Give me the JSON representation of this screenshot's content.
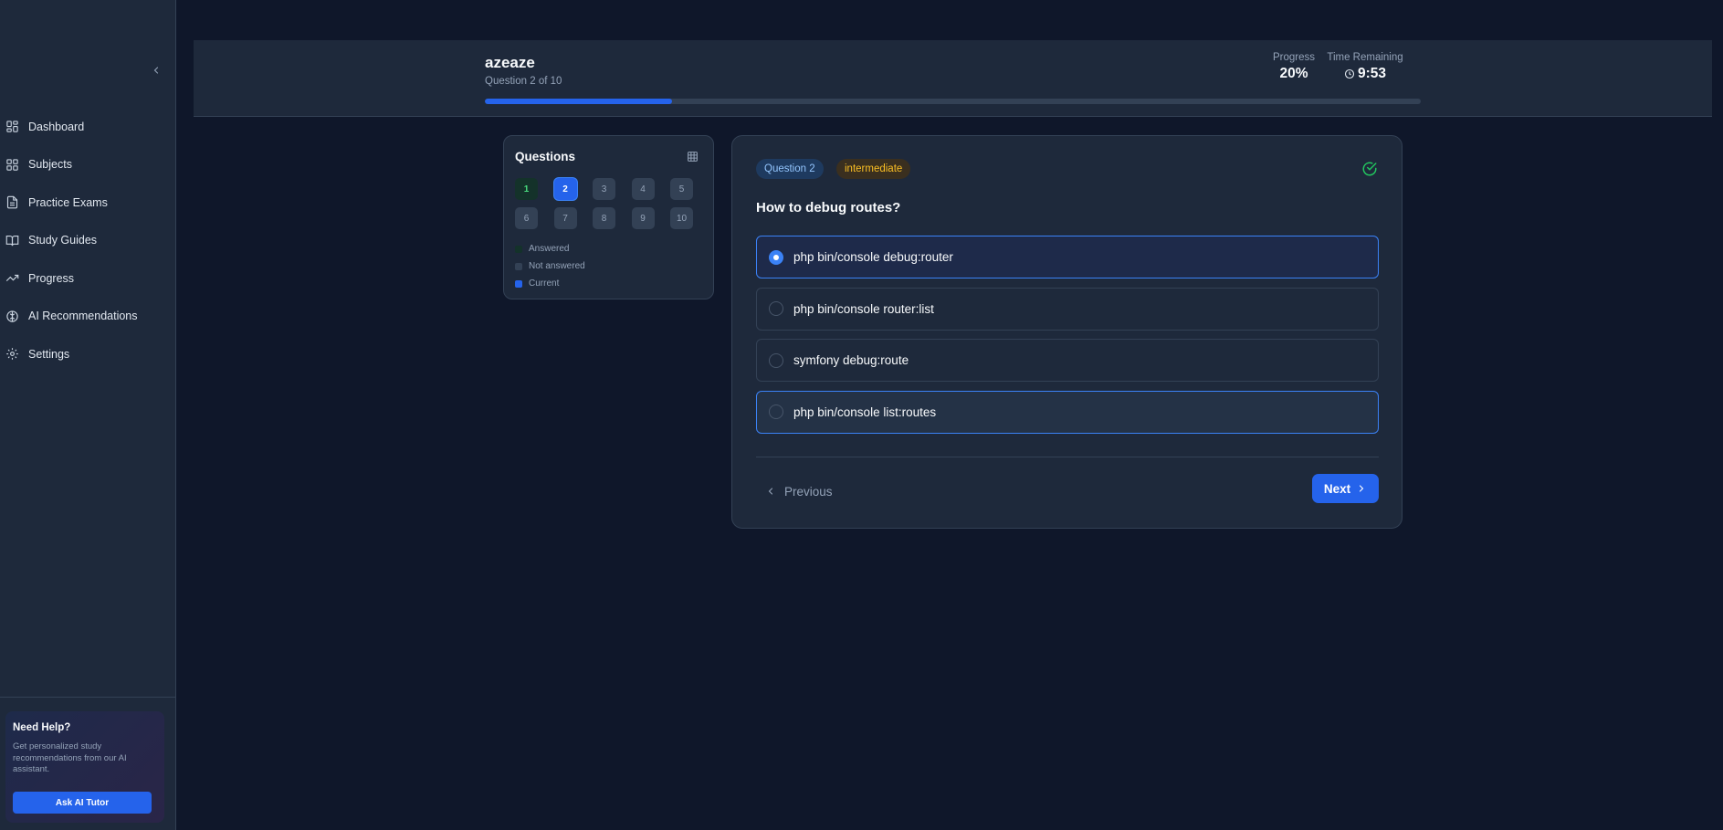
{
  "sidebar": {
    "items": [
      {
        "label": "Dashboard",
        "icon": "dashboard-icon"
      },
      {
        "label": "Subjects",
        "icon": "grid-icon"
      },
      {
        "label": "Practice Exams",
        "icon": "document-icon"
      },
      {
        "label": "Study Guides",
        "icon": "book-icon"
      },
      {
        "label": "Progress",
        "icon": "trending-up-icon"
      },
      {
        "label": "AI Recommendations",
        "icon": "brain-icon"
      },
      {
        "label": "Settings",
        "icon": "gear-icon"
      }
    ],
    "help": {
      "title": "Need Help?",
      "text": "Get personalized study recommendations from our AI assistant.",
      "button": "Ask AI Tutor"
    }
  },
  "header": {
    "title": "azeaze",
    "subtitle": "Question 2 of 10",
    "progress_label": "Progress",
    "progress_value": "20%",
    "progress_fraction": 0.2,
    "time_label": "Time Remaining",
    "time_value": "9:53"
  },
  "questions_panel": {
    "title": "Questions",
    "numbers": [
      "1",
      "2",
      "3",
      "4",
      "5",
      "6",
      "7",
      "8",
      "9",
      "10"
    ],
    "legend": {
      "answered": "Answered",
      "not_answered": "Not answered",
      "current": "Current"
    }
  },
  "question": {
    "badge": "Question 2",
    "level": "intermediate",
    "text": "How to debug routes?",
    "options": [
      "php bin/console debug:router",
      "php bin/console router:list",
      "symfony debug:route",
      "php bin/console list:routes"
    ],
    "previous": "Previous",
    "next": "Next"
  },
  "colors": {
    "background": "#0f172a",
    "surface": "#1e293b",
    "accent": "#2563eb",
    "success": "#22c55e",
    "warning": "#fbbf24"
  }
}
